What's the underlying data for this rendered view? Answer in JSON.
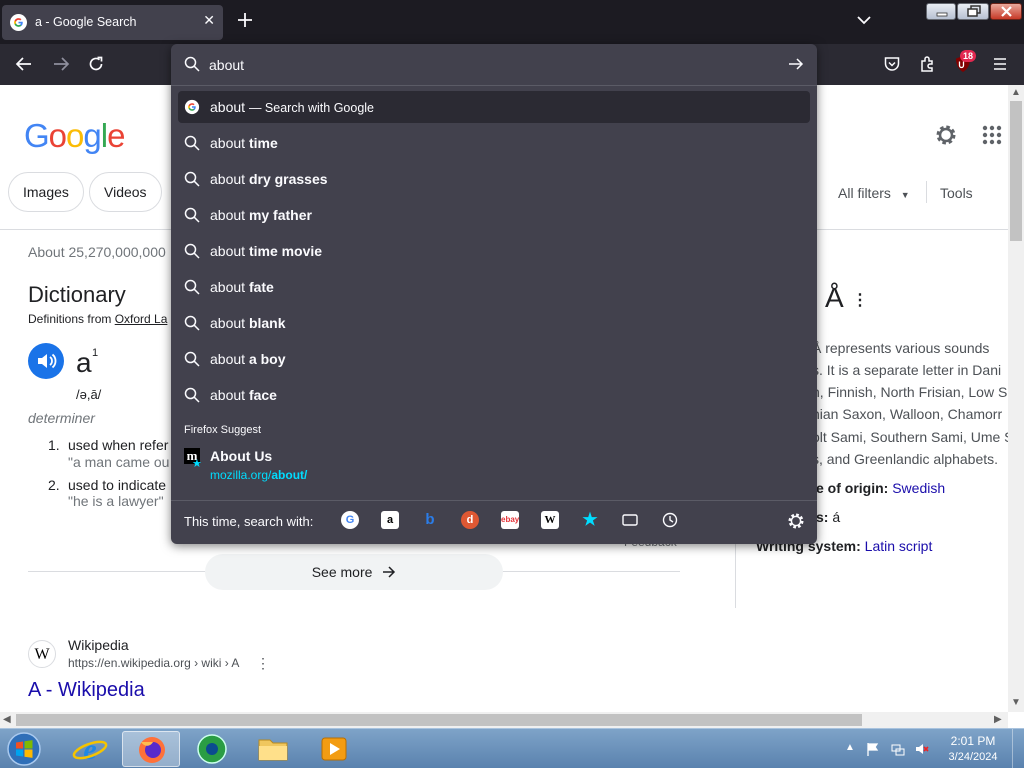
{
  "browser": {
    "tab": {
      "title": "a - Google Search",
      "close": "✕"
    },
    "badge_count": "18",
    "window_buttons": {
      "minimize": "–",
      "maximize": "▭",
      "close": "✕"
    }
  },
  "urlbar": {
    "value": "about",
    "rows": [
      {
        "prefix": "about",
        "bold": "",
        "action": "— Search with Google",
        "icon": "google-g-icon",
        "selected": true
      },
      {
        "prefix": "about ",
        "bold": "time",
        "icon": "search-icon"
      },
      {
        "prefix": "about ",
        "bold": "dry grasses",
        "icon": "search-icon"
      },
      {
        "prefix": "about ",
        "bold": "my father",
        "icon": "search-icon"
      },
      {
        "prefix": "about ",
        "bold": "time movie",
        "icon": "search-icon"
      },
      {
        "prefix": "about ",
        "bold": "fate",
        "icon": "search-icon"
      },
      {
        "prefix": "about ",
        "bold": "blank",
        "icon": "search-icon"
      },
      {
        "prefix": "about ",
        "bold": "a boy",
        "icon": "search-icon"
      },
      {
        "prefix": "about ",
        "bold": "face",
        "icon": "search-icon"
      }
    ],
    "suggest": {
      "heading": "Firefox Suggest",
      "title": "About Us",
      "url_prefix": "mozilla.org/",
      "url_bold": "about/"
    },
    "oneoff_label": "This time, search with:",
    "engines": [
      "google",
      "amazon",
      "bing",
      "duckduckgo",
      "ebay",
      "wikipedia",
      "bookmarks",
      "tabs",
      "history"
    ]
  },
  "google": {
    "logo": "Google",
    "chips": [
      "Images",
      "Videos"
    ],
    "all_filters": "All filters",
    "tools": "Tools",
    "result_stats": "About 25,270,000,000",
    "dictionary": {
      "title": "Dictionary",
      "source_prefix": "Definitions from ",
      "source_link": "Oxford La",
      "headword": "a",
      "superscript": "1",
      "pronunciation": "/ə,ā/",
      "part_of_speech": "determiner",
      "definitions": [
        {
          "num": "1.",
          "text": "used when refer",
          "example": "\"a man came ou"
        },
        {
          "num": "2.",
          "text": "used to indicate",
          "example": "\"he is a lawyer\""
        }
      ],
      "feedback": "Feedback",
      "see_more": "See more"
    },
    "knowledge_panel": {
      "title": "Å",
      "lines": [
        "Å represents various sounds",
        "s. It is a separate letter in Dani",
        "n, Finnish, North Frisian, Low S",
        "nian Saxon, Walloon, Chamorr",
        "olt Sami, Southern Sami, Ume S",
        "s, and Greenlandic alphabets."
      ],
      "fact1_label": "e of origin:",
      "fact1_value": "Swedish",
      "fact2_label": "s:",
      "fact2_value": "á",
      "fact3_label": "Writing system:",
      "fact3_value": "Latin script"
    },
    "wiki": {
      "icon": "W",
      "site": "Wikipedia",
      "url": "https://en.wikipedia.org › wiki › A",
      "title": "A - Wikipedia"
    }
  },
  "taskbar": {
    "time": "2:01 PM",
    "date": "3/24/2024",
    "apps": [
      "internet-explorer",
      "firefox",
      "media-center",
      "file-explorer",
      "media-player"
    ]
  },
  "colors": {
    "panel_bg": "#42414d",
    "toolbar_bg": "#2b2a33",
    "titlebar_bg": "#1c1b22",
    "link_blue": "#1a0dab",
    "firefox_accent": "#00ddff"
  }
}
